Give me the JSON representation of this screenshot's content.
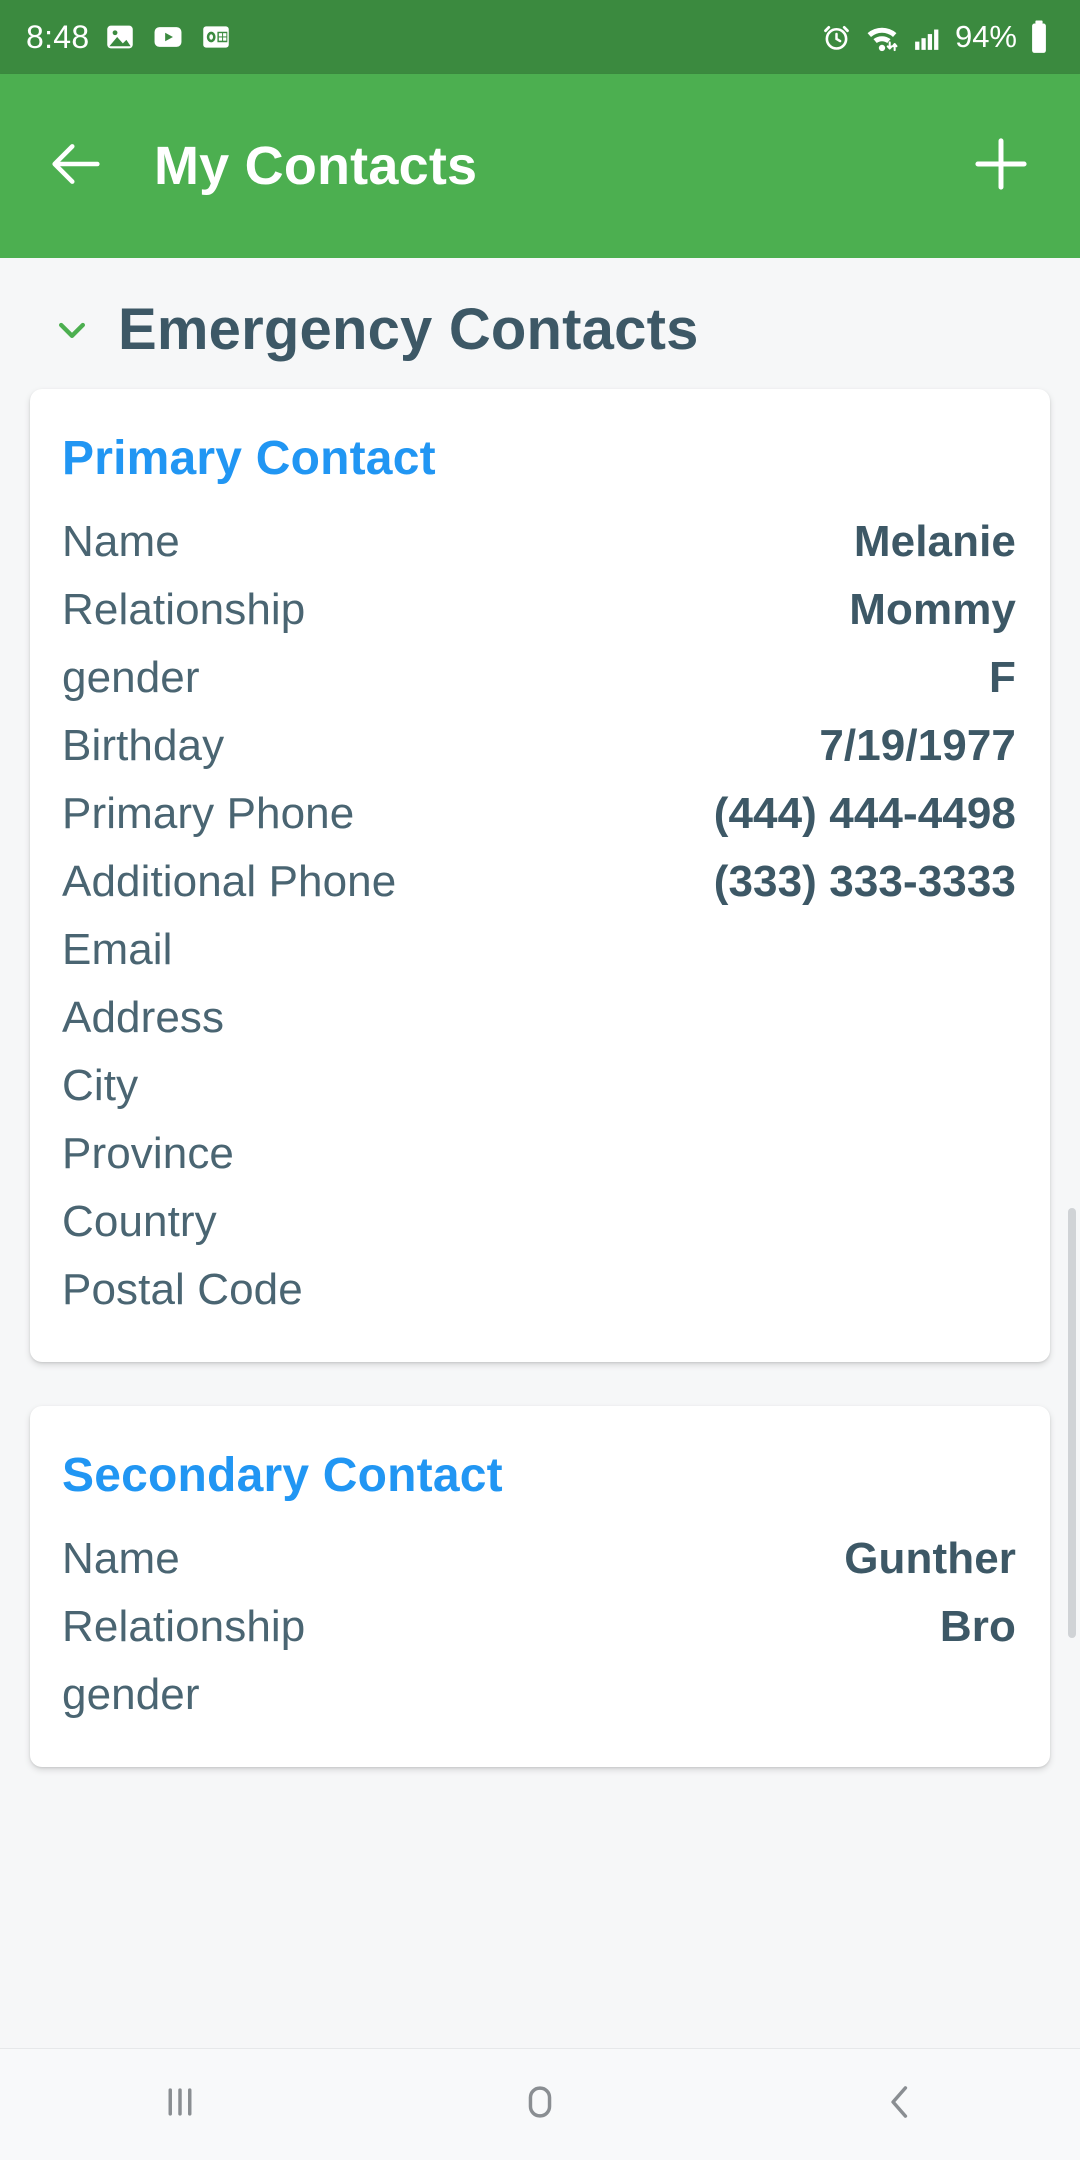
{
  "status_bar": {
    "time": "8:48",
    "battery_percent": "94%",
    "left_icons": [
      "gallery-icon",
      "youtube-icon",
      "outlook-icon"
    ],
    "right_icons": [
      "alarm-icon",
      "wifi-icon",
      "cellular-signal-icon",
      "battery-icon"
    ],
    "background_color": "#3b8a3f"
  },
  "app_bar": {
    "title": "My Contacts",
    "back_icon": "arrow-left-icon",
    "add_icon": "plus-icon",
    "background_color": "#4caf50",
    "text_color": "#ffffff"
  },
  "section": {
    "title": "Emergency Contacts",
    "expanded": true,
    "chevron_icon": "chevron-down-icon",
    "chevron_color": "#4caf50",
    "title_color": "#3d5866"
  },
  "cards": [
    {
      "title": "Primary Contact",
      "title_color": "#2196f3",
      "rows": [
        {
          "label": "Name",
          "value": "Melanie"
        },
        {
          "label": "Relationship",
          "value": "Mommy"
        },
        {
          "label": "gender",
          "value": "F"
        },
        {
          "label": "Birthday",
          "value": "7/19/1977"
        },
        {
          "label": "Primary Phone",
          "value": "(444) 444-4498"
        },
        {
          "label": "Additional Phone",
          "value": "(333) 333-3333"
        },
        {
          "label": "Email",
          "value": ""
        },
        {
          "label": "Address",
          "value": ""
        },
        {
          "label": "City",
          "value": ""
        },
        {
          "label": "Province",
          "value": ""
        },
        {
          "label": "Country",
          "value": ""
        },
        {
          "label": "Postal Code",
          "value": ""
        }
      ]
    },
    {
      "title": "Secondary Contact",
      "title_color": "#2196f3",
      "rows": [
        {
          "label": "Name",
          "value": "Gunther"
        },
        {
          "label": "Relationship",
          "value": "Bro"
        },
        {
          "label": "gender",
          "value": ""
        }
      ]
    }
  ],
  "nav_bar": {
    "recents_icon": "recents-icon",
    "home_icon": "home-icon",
    "back_icon": "back-chevron-icon",
    "background_color": "#f8f9fa"
  }
}
